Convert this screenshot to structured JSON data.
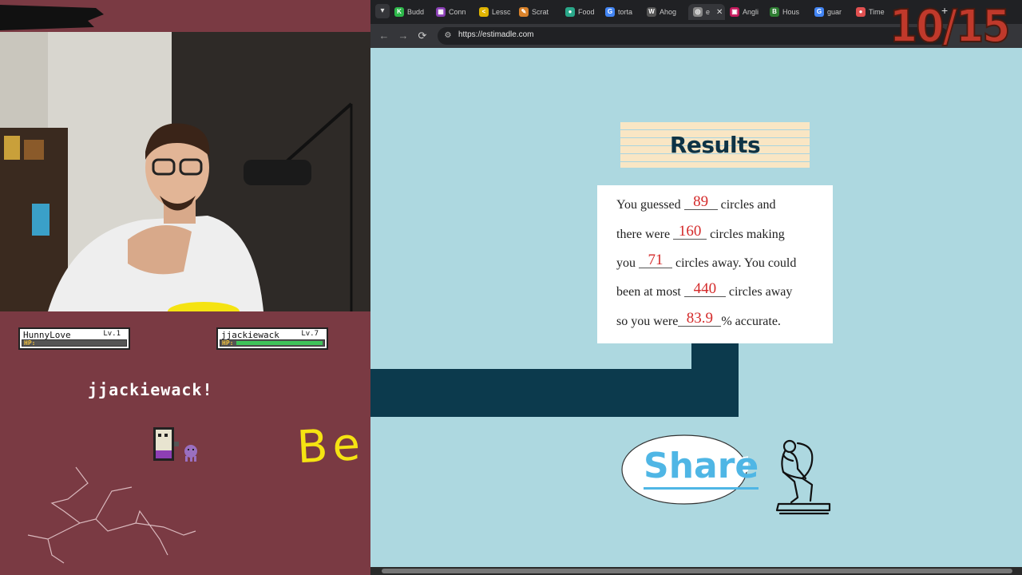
{
  "stream": {
    "player1": {
      "name": "HunnyLove",
      "level": "Lv.1",
      "hp_label": "HP:",
      "hp_fill": 0.0
    },
    "player2": {
      "name": "jjackiewack",
      "level": "Lv.7",
      "hp_label": "HP:",
      "hp_fill": 1.0
    },
    "battle_text": "jjackiewack!",
    "handwritten": "Be"
  },
  "browser": {
    "tabs": [
      {
        "label": "Budd",
        "fav": "K",
        "color": "#2db84a"
      },
      {
        "label": "Conn",
        "fav": "▦",
        "color": "#8a3fb5"
      },
      {
        "label": "Lessc",
        "fav": "<",
        "color": "#e0b400"
      },
      {
        "label": "Scrat",
        "fav": "✎",
        "color": "#d9822b"
      },
      {
        "label": "Food",
        "fav": "●",
        "color": "#2aa88a"
      },
      {
        "label": "torta",
        "fav": "G",
        "color": "#4285f4"
      },
      {
        "label": "Ahog",
        "fav": "W",
        "color": "#555555"
      },
      {
        "label": "e",
        "fav": "◎",
        "color": "#888888",
        "active": true
      },
      {
        "label": "Angli",
        "fav": "▣",
        "color": "#c2185b"
      },
      {
        "label": "Hous",
        "fav": "B",
        "color": "#2e7d32"
      },
      {
        "label": "guar",
        "fav": "G",
        "color": "#4285f4"
      },
      {
        "label": "Time",
        "fav": "●",
        "color": "#e05050"
      }
    ],
    "url": "https://estimadle.com",
    "counter": "10/15"
  },
  "results": {
    "title": "Results",
    "line1_pre": "You guessed",
    "guess": "89",
    "line1_post": "circles and",
    "line2_pre": "there were",
    "actual": "160",
    "line2_post": "circles making",
    "line3_pre": "you",
    "diff": "71",
    "line3_post": "circles away. You could",
    "line4_pre": "been at most",
    "max": "440",
    "line4_post": "circles away",
    "line5_pre": "so you were",
    "accuracy": "83.9",
    "line5_post": "% accurate.",
    "share": "Share"
  }
}
